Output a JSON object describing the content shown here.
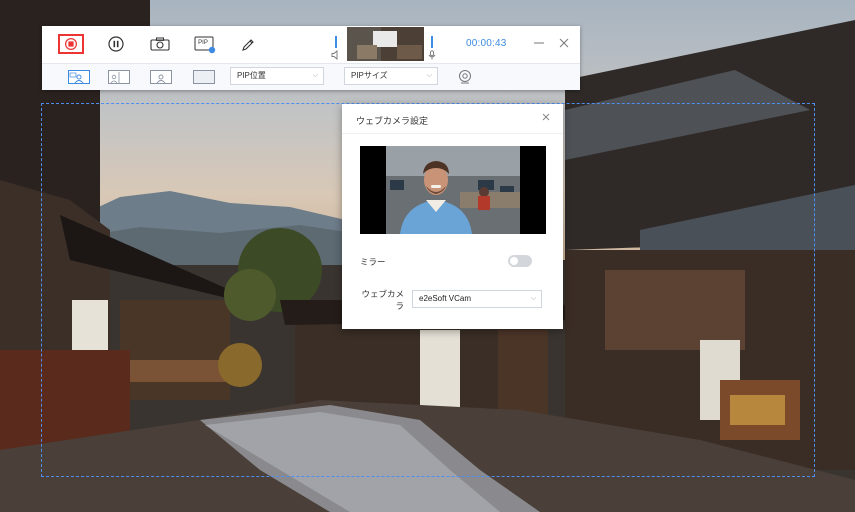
{
  "toolbar": {
    "record_controls": [
      "stop-icon",
      "pause-icon",
      "camera-icon",
      "pip-icon",
      "pen-icon"
    ],
    "pip_badge": "PIP",
    "timer": "00:00:43",
    "window_controls": [
      "minimize-icon",
      "close-icon"
    ],
    "layouts": [
      "layout-pip-top",
      "layout-side-by-side",
      "layout-webcam-only",
      "layout-screen-only"
    ],
    "pip_position": {
      "value": "PIP位置"
    },
    "pip_size": {
      "value": "PIPサイズ"
    }
  },
  "dialog": {
    "title": "ウェブカメラ設定",
    "mirror_label": "ミラー",
    "mirror_on": false,
    "webcam_label": "ウェブカメラ",
    "webcam_value": "e2eSoft VCam"
  },
  "colors": {
    "accent": "#3d8be0",
    "stop": "#e33333",
    "record_area_border": "#4d8ef0"
  }
}
